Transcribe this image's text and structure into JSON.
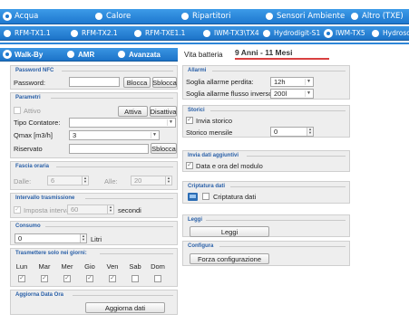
{
  "tabs_row1": [
    {
      "label": "Acqua",
      "selected": true
    },
    {
      "label": "Calore",
      "selected": false
    },
    {
      "label": "Ripartitori",
      "selected": false
    },
    {
      "label": "Sensori Ambiente",
      "selected": false
    },
    {
      "label": "Altro (TXE)",
      "selected": false
    }
  ],
  "tabs_row2": [
    {
      "label": "RFM-TX1.1",
      "selected": false
    },
    {
      "label": "RFM-TX2.1",
      "selected": false
    },
    {
      "label": "RFM-TXE1.1",
      "selected": false
    },
    {
      "label": "IWM-TX3\\TX4",
      "selected": false
    },
    {
      "label": "Hydrodigit-S1",
      "selected": false
    },
    {
      "label": "IWM-TX5",
      "selected": true
    },
    {
      "label": "Hydrosonic",
      "selected": false
    }
  ],
  "tabs_row3": [
    {
      "label": "Walk-By",
      "selected": true
    },
    {
      "label": "AMR",
      "selected": false
    },
    {
      "label": "Avanzata",
      "selected": false
    }
  ],
  "battery": {
    "label": "Vita batteria",
    "value": "9 Anni - 11 Mesi"
  },
  "password": {
    "title": "Password NFC",
    "label": "Password:",
    "value": "",
    "lock_button": "Blocca",
    "unlock_button": "Sblocca"
  },
  "parametri": {
    "title": "Parametri",
    "active_label": "Attivo",
    "activate_button": "Attiva",
    "deactivate_button": "Disattiva",
    "counter_type_label": "Tipo Contatore:",
    "counter_type_value": "",
    "qmax_label": "Qmax [m3/h]",
    "qmax_value": "3",
    "reserved_label": "Riservato",
    "reserved_value": "",
    "unlock_button": "Sblocca"
  },
  "fascia": {
    "title": "Fascia oraria",
    "from_label": "Dalle:",
    "from_value": "6",
    "to_label": "Alle:",
    "to_value": "20"
  },
  "intervallo": {
    "title": "Intervallo trasmissione",
    "checkbox_label": "Imposta intervallo",
    "checked": true,
    "value": "60",
    "unit": "secondi"
  },
  "consumo": {
    "title": "Consumo",
    "value": "0",
    "unit": "Litri"
  },
  "giorni": {
    "title": "Trasmettere solo nei giorni:",
    "days": [
      {
        "label": "Lun",
        "checked": true
      },
      {
        "label": "Mar",
        "checked": true
      },
      {
        "label": "Mer",
        "checked": true
      },
      {
        "label": "Gio",
        "checked": true
      },
      {
        "label": "Ven",
        "checked": true
      },
      {
        "label": "Sab",
        "checked": false
      },
      {
        "label": "Dom",
        "checked": false
      }
    ]
  },
  "data_ora": {
    "title": "Aggiorna Data Ora",
    "button": "Aggiorna dati"
  },
  "allarmi": {
    "title": "Allarmi",
    "leak_label": "Soglia allarme perdita:",
    "leak_value": "12h",
    "reverse_label": "Soglia allarme flusso inverso:",
    "reverse_value": "200l"
  },
  "storici": {
    "title": "Storici",
    "send_label": "Invia storico",
    "send_checked": true,
    "monthly_label": "Storico mensile",
    "monthly_value": "0"
  },
  "aggiuntivi": {
    "title": "Invia dati aggiuntivi",
    "label": "Data e ora del modulo",
    "checked": true
  },
  "cripto": {
    "title": "Criptatura dati",
    "label": "Criptatura dati",
    "checked": false
  },
  "leggi": {
    "title": "Leggi",
    "button": "Leggi"
  },
  "configura": {
    "title": "Configura",
    "button": "Forza configurazione"
  },
  "colors": {
    "tab_blue": "#1e78cf",
    "panel_title": "#2a60a8",
    "battery_line": "#d94040"
  }
}
